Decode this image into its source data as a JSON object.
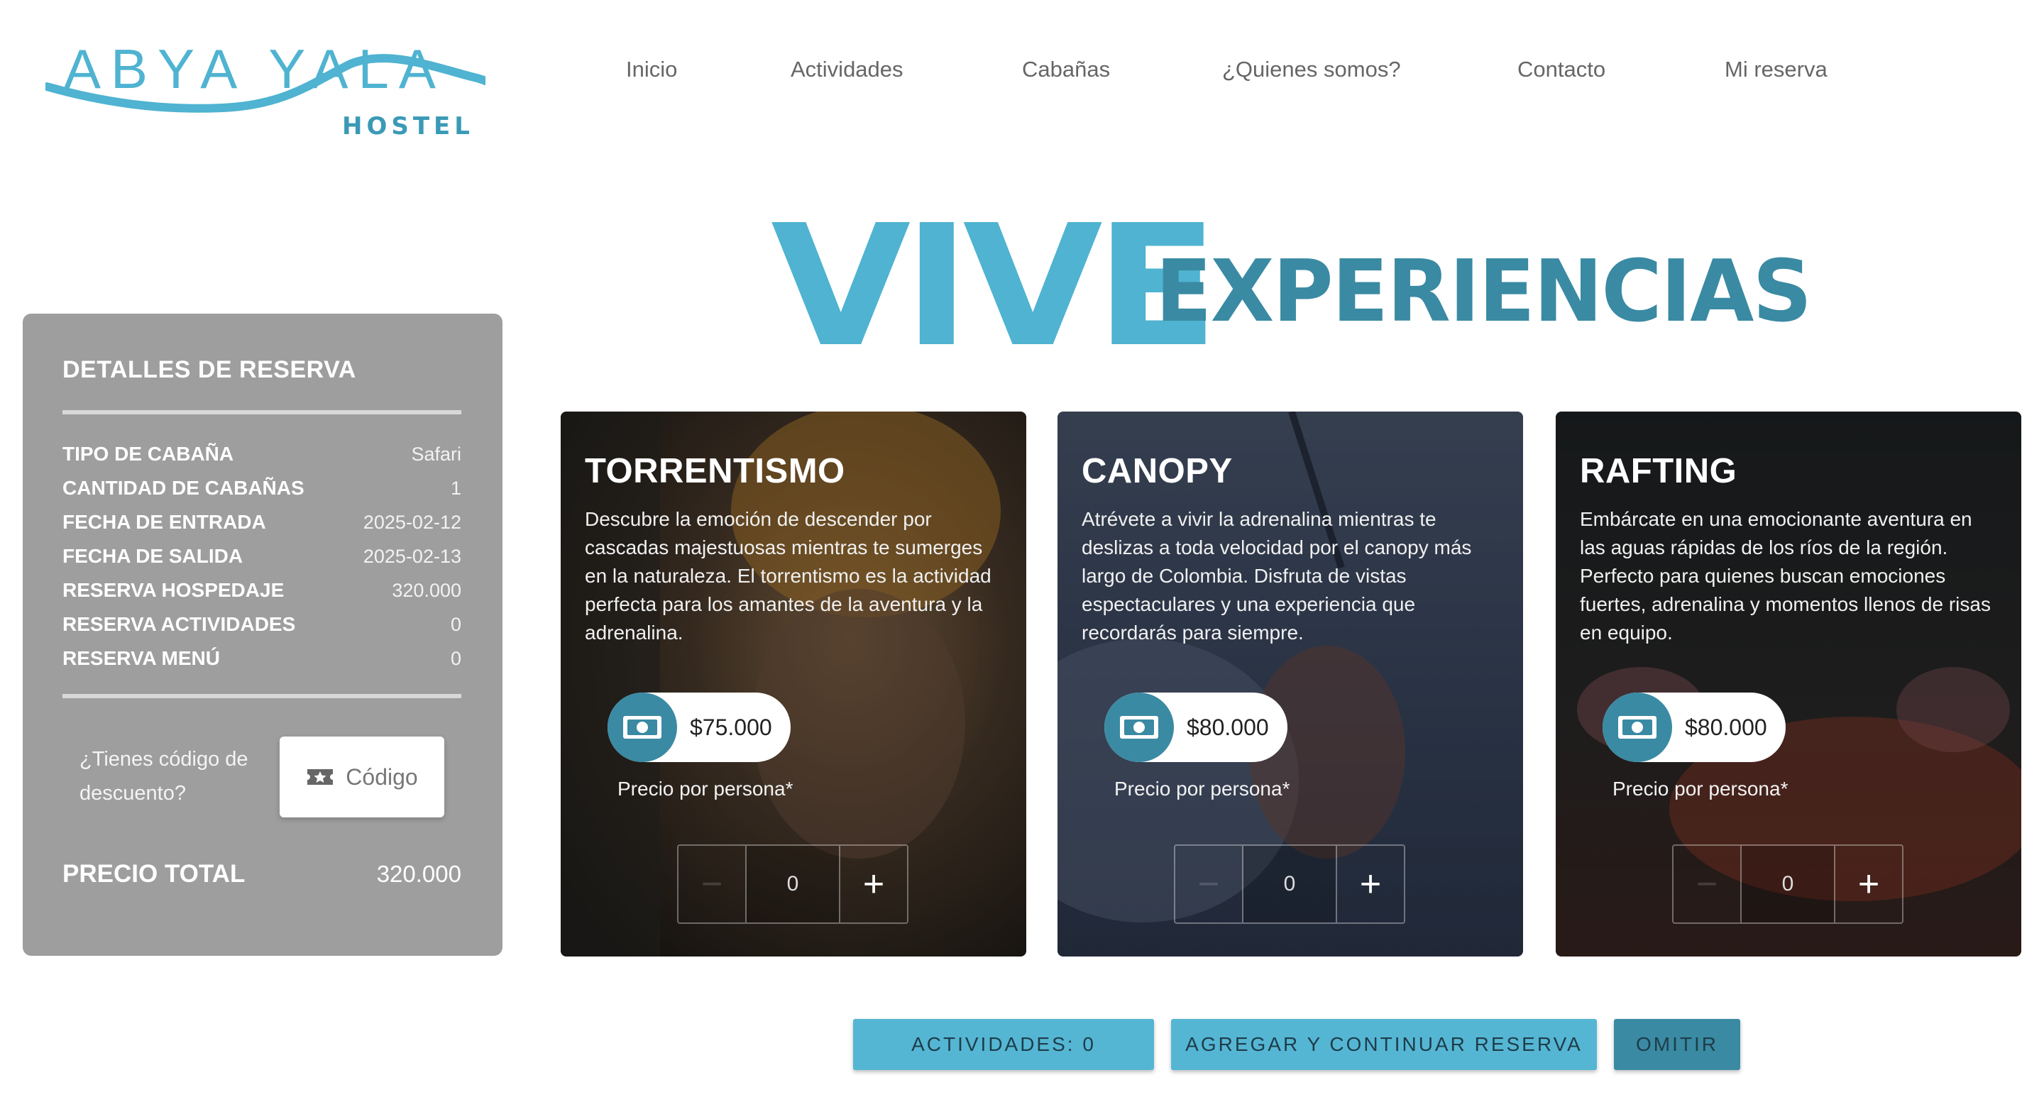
{
  "header": {
    "logo_text": "ABYA YALA",
    "logo_sub": "HOSTEL",
    "nav": [
      {
        "label": "Inicio"
      },
      {
        "label": "Actividades"
      },
      {
        "label": "Cabañas"
      },
      {
        "label": "¿Quienes somos?"
      },
      {
        "label": "Contacto"
      },
      {
        "label": "Mi reserva"
      }
    ]
  },
  "hero": {
    "big": "VIVE",
    "rest": "EXPERIENCIAS"
  },
  "reservation": {
    "title": "DETALLES DE RESERVA",
    "rows": [
      {
        "label": "TIPO DE CABAÑA",
        "value": "Safari"
      },
      {
        "label": "CANTIDAD DE CABAÑAS",
        "value": "1"
      },
      {
        "label": "FECHA DE ENTRADA",
        "value": "2025-02-12"
      },
      {
        "label": "FECHA DE SALIDA",
        "value": "2025-02-13"
      },
      {
        "label": "RESERVA HOSPEDAJE",
        "value": "320.000"
      },
      {
        "label": "RESERVA ACTIVIDADES",
        "value": "0"
      },
      {
        "label": "RESERVA MENÚ",
        "value": "0"
      }
    ],
    "promo_text": "¿Tienes código de descuento?",
    "code_button": "Código",
    "total_label": "PRECIO TOTAL",
    "total_value": "320.000"
  },
  "activities": [
    {
      "title": "TORRENTISMO",
      "description": "Descubre la emoción de descender por cascadas majestuosas mientras te sumerges en la naturaleza. El torrentismo es la actividad perfecta para los amantes de la aventura y la adrenalina.",
      "price": "$75.000",
      "price_note": "Precio por persona*",
      "quantity": "0"
    },
    {
      "title": "CANOPY",
      "description": "Atrévete a vivir la adrenalina mientras te deslizas a toda velocidad por el canopy más largo de Colombia. Disfruta de vistas espectaculares y una experiencia que recordarás para siempre.",
      "price": "$80.000",
      "price_note": "Precio por persona*",
      "quantity": "0"
    },
    {
      "title": "RAFTING",
      "description": "Embárcate en una emocionante aventura en las aguas rápidas de los ríos de la región. Perfecto para quienes buscan emociones fuertes, adrenalina y momentos llenos de risas en equipo.",
      "price": "$80.000",
      "price_note": "Precio por persona*",
      "quantity": "0"
    }
  ],
  "actions": {
    "activities_count": "ACTIVIDADES: 0",
    "continue": "AGREGAR Y CONTINUAR RESERVA",
    "skip": "OMITIR"
  },
  "colors": {
    "brand_light": "#4fb3d1",
    "brand_dark": "#3a8aa3",
    "sidebar_bg": "#9e9e9e"
  }
}
